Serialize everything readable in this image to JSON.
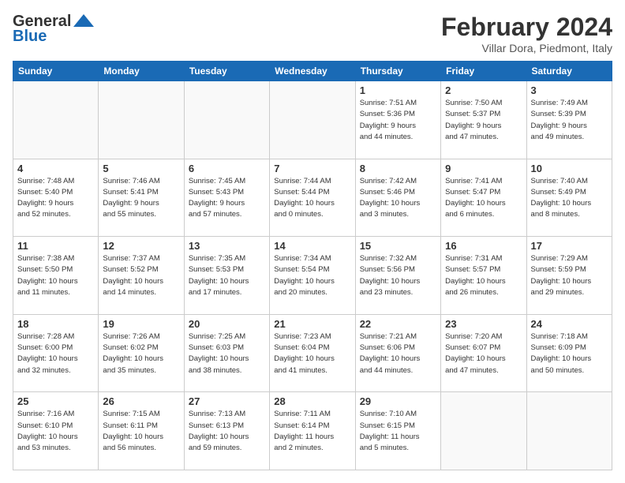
{
  "header": {
    "logo_line1": "General",
    "logo_line2": "Blue",
    "month_title": "February 2024",
    "location": "Villar Dora, Piedmont, Italy"
  },
  "weekdays": [
    "Sunday",
    "Monday",
    "Tuesday",
    "Wednesday",
    "Thursday",
    "Friday",
    "Saturday"
  ],
  "weeks": [
    [
      {
        "day": "",
        "info": ""
      },
      {
        "day": "",
        "info": ""
      },
      {
        "day": "",
        "info": ""
      },
      {
        "day": "",
        "info": ""
      },
      {
        "day": "1",
        "info": "Sunrise: 7:51 AM\nSunset: 5:36 PM\nDaylight: 9 hours\nand 44 minutes."
      },
      {
        "day": "2",
        "info": "Sunrise: 7:50 AM\nSunset: 5:37 PM\nDaylight: 9 hours\nand 47 minutes."
      },
      {
        "day": "3",
        "info": "Sunrise: 7:49 AM\nSunset: 5:39 PM\nDaylight: 9 hours\nand 49 minutes."
      }
    ],
    [
      {
        "day": "4",
        "info": "Sunrise: 7:48 AM\nSunset: 5:40 PM\nDaylight: 9 hours\nand 52 minutes."
      },
      {
        "day": "5",
        "info": "Sunrise: 7:46 AM\nSunset: 5:41 PM\nDaylight: 9 hours\nand 55 minutes."
      },
      {
        "day": "6",
        "info": "Sunrise: 7:45 AM\nSunset: 5:43 PM\nDaylight: 9 hours\nand 57 minutes."
      },
      {
        "day": "7",
        "info": "Sunrise: 7:44 AM\nSunset: 5:44 PM\nDaylight: 10 hours\nand 0 minutes."
      },
      {
        "day": "8",
        "info": "Sunrise: 7:42 AM\nSunset: 5:46 PM\nDaylight: 10 hours\nand 3 minutes."
      },
      {
        "day": "9",
        "info": "Sunrise: 7:41 AM\nSunset: 5:47 PM\nDaylight: 10 hours\nand 6 minutes."
      },
      {
        "day": "10",
        "info": "Sunrise: 7:40 AM\nSunset: 5:49 PM\nDaylight: 10 hours\nand 8 minutes."
      }
    ],
    [
      {
        "day": "11",
        "info": "Sunrise: 7:38 AM\nSunset: 5:50 PM\nDaylight: 10 hours\nand 11 minutes."
      },
      {
        "day": "12",
        "info": "Sunrise: 7:37 AM\nSunset: 5:52 PM\nDaylight: 10 hours\nand 14 minutes."
      },
      {
        "day": "13",
        "info": "Sunrise: 7:35 AM\nSunset: 5:53 PM\nDaylight: 10 hours\nand 17 minutes."
      },
      {
        "day": "14",
        "info": "Sunrise: 7:34 AM\nSunset: 5:54 PM\nDaylight: 10 hours\nand 20 minutes."
      },
      {
        "day": "15",
        "info": "Sunrise: 7:32 AM\nSunset: 5:56 PM\nDaylight: 10 hours\nand 23 minutes."
      },
      {
        "day": "16",
        "info": "Sunrise: 7:31 AM\nSunset: 5:57 PM\nDaylight: 10 hours\nand 26 minutes."
      },
      {
        "day": "17",
        "info": "Sunrise: 7:29 AM\nSunset: 5:59 PM\nDaylight: 10 hours\nand 29 minutes."
      }
    ],
    [
      {
        "day": "18",
        "info": "Sunrise: 7:28 AM\nSunset: 6:00 PM\nDaylight: 10 hours\nand 32 minutes."
      },
      {
        "day": "19",
        "info": "Sunrise: 7:26 AM\nSunset: 6:02 PM\nDaylight: 10 hours\nand 35 minutes."
      },
      {
        "day": "20",
        "info": "Sunrise: 7:25 AM\nSunset: 6:03 PM\nDaylight: 10 hours\nand 38 minutes."
      },
      {
        "day": "21",
        "info": "Sunrise: 7:23 AM\nSunset: 6:04 PM\nDaylight: 10 hours\nand 41 minutes."
      },
      {
        "day": "22",
        "info": "Sunrise: 7:21 AM\nSunset: 6:06 PM\nDaylight: 10 hours\nand 44 minutes."
      },
      {
        "day": "23",
        "info": "Sunrise: 7:20 AM\nSunset: 6:07 PM\nDaylight: 10 hours\nand 47 minutes."
      },
      {
        "day": "24",
        "info": "Sunrise: 7:18 AM\nSunset: 6:09 PM\nDaylight: 10 hours\nand 50 minutes."
      }
    ],
    [
      {
        "day": "25",
        "info": "Sunrise: 7:16 AM\nSunset: 6:10 PM\nDaylight: 10 hours\nand 53 minutes."
      },
      {
        "day": "26",
        "info": "Sunrise: 7:15 AM\nSunset: 6:11 PM\nDaylight: 10 hours\nand 56 minutes."
      },
      {
        "day": "27",
        "info": "Sunrise: 7:13 AM\nSunset: 6:13 PM\nDaylight: 10 hours\nand 59 minutes."
      },
      {
        "day": "28",
        "info": "Sunrise: 7:11 AM\nSunset: 6:14 PM\nDaylight: 11 hours\nand 2 minutes."
      },
      {
        "day": "29",
        "info": "Sunrise: 7:10 AM\nSunset: 6:15 PM\nDaylight: 11 hours\nand 5 minutes."
      },
      {
        "day": "",
        "info": ""
      },
      {
        "day": "",
        "info": ""
      }
    ]
  ]
}
